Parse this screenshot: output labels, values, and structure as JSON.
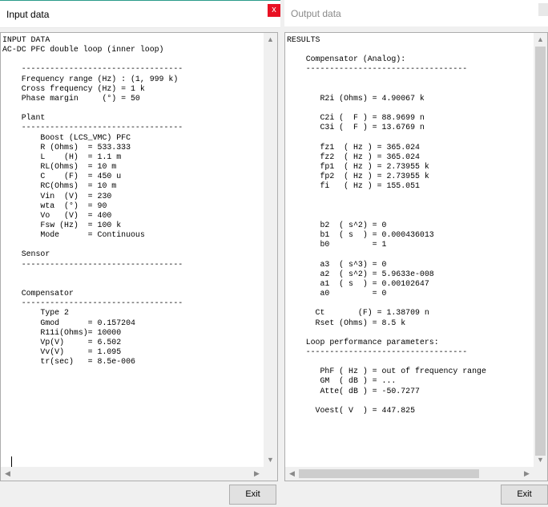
{
  "left_window": {
    "title": "Input data",
    "close_label": "x",
    "content": "INPUT DATA\nAC-DC PFC double loop (inner loop)\n\n    ----------------------------------\n    Frequency range (Hz) : (1, 999 k)\n    Cross frequency (Hz) = 1 k\n    Phase margin     (°) = 50\n\n    Plant\n    ----------------------------------\n        Boost (LCS_VMC) PFC\n        R (Ohms)  = 533.333\n        L    (H)  = 1.1 m\n        RL(Ohms)  = 10 m\n        C    (F)  = 450 u\n        RC(Ohms)  = 10 m\n        Vin  (V)  = 230\n        wta  (°)  = 90\n        Vo   (V)  = 400\n        Fsw (Hz)  = 100 k\n        Mode      = Continuous\n\n    Sensor\n    ----------------------------------\n\n\n    Compensator\n    ----------------------------------\n        Type 2\n        Gmod      = 0.157204\n        R11i(Ohms)= 10000\n        Vp(V)     = 6.502\n        Vv(V)     = 1.095\n        tr(sec)   = 8.5e-006",
    "exit_label": "Exit"
  },
  "right_window": {
    "title": "Output data",
    "content": "RESULTS\n\n    Compensator (Analog):\n    ----------------------------------\n\n\n       R2i (Ohms) = 4.90067 k\n\n       C2i (  F ) = 88.9699 n\n       C3i (  F ) = 13.6769 n\n\n       fz1  ( Hz ) = 365.024\n       fz2  ( Hz ) = 365.024\n       fp1  ( Hz ) = 2.73955 k\n       fp2  ( Hz ) = 2.73955 k\n       fi   ( Hz ) = 155.051\n\n\n\n       b2  ( s^2) = 0\n       b1  ( s  ) = 0.000436013\n       b0         = 1\n\n       a3  ( s^3) = 0\n       a2  ( s^2) = 5.9633e-008\n       a1  ( s  ) = 0.00102647\n       a0         = 0\n\n      Ct       (F) = 1.38709 n\n      Rset (Ohms) = 8.5 k\n\n    Loop performance parameters:\n    ----------------------------------\n\n       PhF ( Hz ) = out of frequency range\n       GM  ( dB ) = ...\n       Atte( dB ) = -50.7277\n\n      Voest( V  ) = 447.825",
    "exit_label": "Exit"
  },
  "icons": {
    "up": "▲",
    "down": "▼",
    "left": "◀",
    "right": "▶"
  }
}
